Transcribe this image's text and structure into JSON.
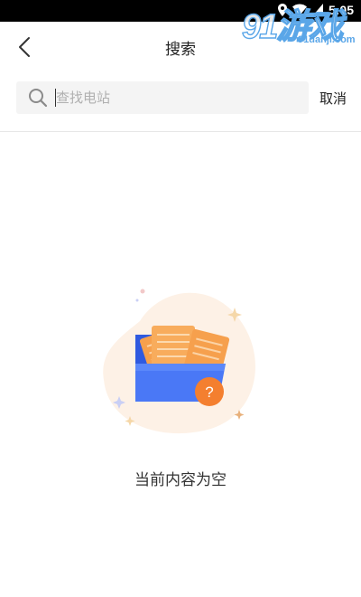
{
  "status_bar": {
    "time": "5:05"
  },
  "watermark": {
    "logo": "91游戏",
    "url": "91danji.com"
  },
  "header": {
    "title": "搜索",
    "back_icon": "chevron-left-icon"
  },
  "search": {
    "placeholder": "查找电站",
    "value": "",
    "cancel_label": "取消",
    "icon": "search-icon"
  },
  "empty_state": {
    "message": "当前内容为空",
    "illustration": "empty-folder-illustration"
  },
  "colors": {
    "folder_blue": "#3d6ef5",
    "card_orange": "#f6a04d",
    "question_badge": "#f47f2f",
    "blob_bg": "#fdf3ea"
  }
}
